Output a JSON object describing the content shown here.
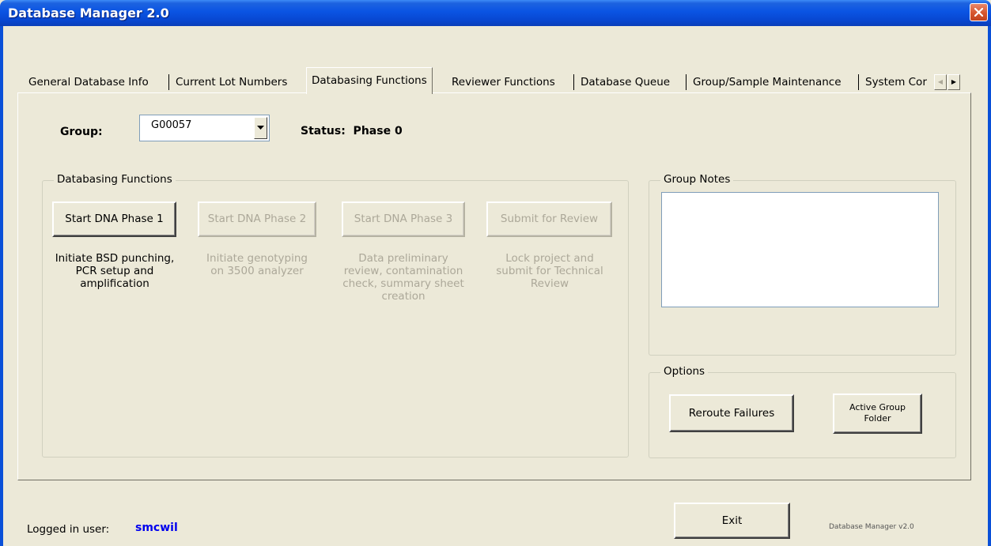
{
  "window": {
    "title": "Database Manager 2.0"
  },
  "tabs": [
    {
      "label": "General Database Info"
    },
    {
      "label": "Current Lot Numbers"
    },
    {
      "label": "Databasing Functions"
    },
    {
      "label": "Reviewer Functions"
    },
    {
      "label": "Database Queue"
    },
    {
      "label": "Group/Sample Maintenance"
    },
    {
      "label": "System Cor"
    }
  ],
  "active_tab": "Databasing Functions",
  "group": {
    "label": "Group:",
    "value": "G00057"
  },
  "status": {
    "text": "Status:  Phase 0"
  },
  "databasing": {
    "title": "Databasing Functions",
    "buttons": [
      {
        "label": "Start DNA Phase 1",
        "enabled": true,
        "desc": [
          "Initiate BSD punching,",
          "PCR setup and",
          "amplification"
        ]
      },
      {
        "label": "Start DNA Phase 2",
        "enabled": false,
        "desc": [
          "Initiate genotyping",
          "on 3500 analyzer"
        ]
      },
      {
        "label": "Start DNA Phase 3",
        "enabled": false,
        "desc": [
          "Data preliminary",
          "review, contamination",
          "check, summary sheet",
          "creation"
        ]
      },
      {
        "label": "Submit for Review",
        "enabled": false,
        "desc": [
          "Lock project and",
          "submit for Technical",
          "Review"
        ]
      }
    ]
  },
  "group_notes": {
    "title": "Group Notes",
    "text": ""
  },
  "options": {
    "title": "Options",
    "reroute_label": "Reroute Failures",
    "active_folder_line1": "Active Group",
    "active_folder_line2": "Folder"
  },
  "footer": {
    "logged_in_label": "Logged in user:",
    "user": "smcwil",
    "exit_label": "Exit",
    "version": "Database Manager v2.0"
  },
  "colors": {
    "titlebar": "#0a54e3",
    "face": "#ece9d8",
    "user": "#0000ee",
    "close": "#d6552e"
  }
}
